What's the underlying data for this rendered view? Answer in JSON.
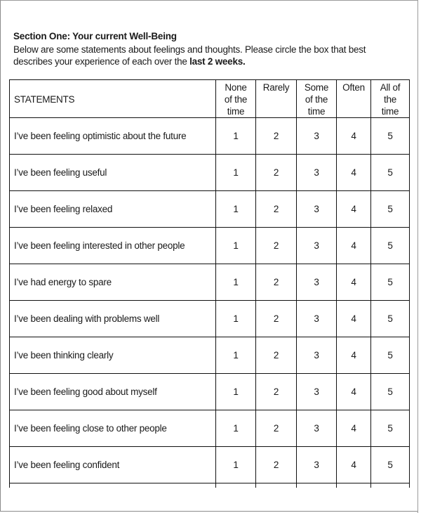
{
  "section": {
    "heading": "Section One: Your current Well-Being",
    "intro_text": "Below are some statements about feelings and thoughts. Please circle the box that best describes your experience of each over the ",
    "intro_bold": "last 2 weeks."
  },
  "table": {
    "statements_header": "STATEMENTS",
    "columns": [
      {
        "label": "None of the time"
      },
      {
        "label": "Rarely"
      },
      {
        "label": "Some of the time"
      },
      {
        "label": "Often"
      },
      {
        "label": "All of the time"
      }
    ],
    "rows": [
      {
        "statement": "I’ve been feeling optimistic about the future",
        "options": [
          "1",
          "2",
          "3",
          "4",
          "5"
        ]
      },
      {
        "statement": "I’ve been feeling useful",
        "options": [
          "1",
          "2",
          "3",
          "4",
          "5"
        ]
      },
      {
        "statement": "I’ve been feeling relaxed",
        "options": [
          "1",
          "2",
          "3",
          "4",
          "5"
        ]
      },
      {
        "statement": "I’ve been feeling interested in other people",
        "options": [
          "1",
          "2",
          "3",
          "4",
          "5"
        ]
      },
      {
        "statement": "I’ve had energy to spare",
        "options": [
          "1",
          "2",
          "3",
          "4",
          "5"
        ]
      },
      {
        "statement": "I’ve been dealing with problems well",
        "options": [
          "1",
          "2",
          "3",
          "4",
          "5"
        ]
      },
      {
        "statement": "I’ve been thinking clearly",
        "options": [
          "1",
          "2",
          "3",
          "4",
          "5"
        ]
      },
      {
        "statement": "I’ve been feeling good about myself",
        "options": [
          "1",
          "2",
          "3",
          "4",
          "5"
        ]
      },
      {
        "statement": "I’ve been feeling close to other people",
        "options": [
          "1",
          "2",
          "3",
          "4",
          "5"
        ]
      },
      {
        "statement": "I’ve been feeling confident",
        "options": [
          "1",
          "2",
          "3",
          "4",
          "5"
        ]
      }
    ]
  }
}
